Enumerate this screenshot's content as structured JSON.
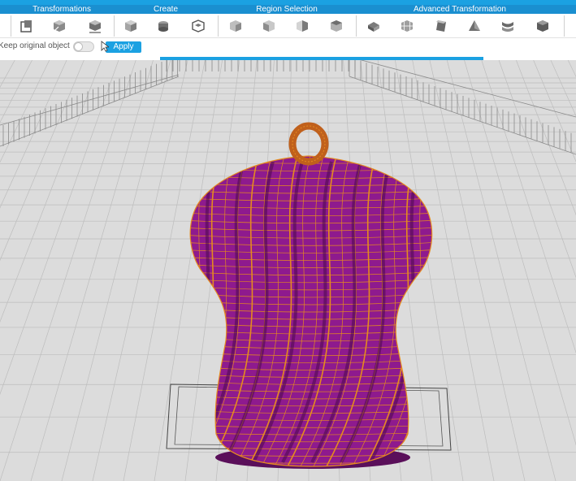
{
  "ribbon": {
    "groups": [
      {
        "label": "Transformations"
      },
      {
        "label": "Create"
      },
      {
        "label": "Region Selection"
      },
      {
        "label": "Advanced Transformation"
      }
    ],
    "tools": {
      "transformations": [
        "transform-icon",
        "cube-scale-icon",
        "cube-align-icon"
      ],
      "create": [
        "cube-create-icon",
        "shape-create-icon",
        "cube-insert-icon"
      ],
      "region_selection": [
        "cube-select-icon",
        "cube-select-face-icon",
        "cube-select-half-icon",
        "cube-select-region-icon"
      ],
      "advanced_transformation": [
        "extrude-icon",
        "cube-grid-icon",
        "twist-icon",
        "taper-icon",
        "bend-icon",
        "cube-dark-icon"
      ]
    }
  },
  "options": {
    "keep_original_label": "Keep original object",
    "keep_original_on": false,
    "apply_label": "Apply"
  },
  "progress": {
    "fraction": 0.56
  },
  "colors": {
    "accent": "#1ba1e2",
    "model_fill": "#8e1a8e",
    "model_wire": "#e58a1f",
    "grid_background": "#dcdcdc"
  }
}
